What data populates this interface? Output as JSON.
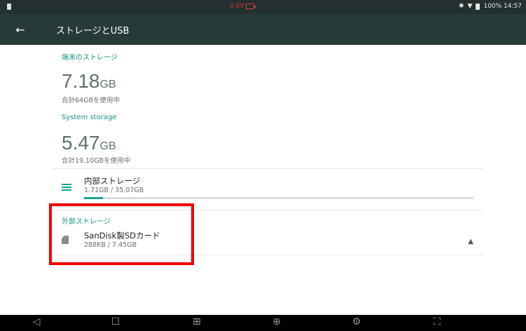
{
  "status_bar": {
    "voltage": "0.0V",
    "right_text": "100% 14:57"
  },
  "toolbar": {
    "back_icon": "←",
    "title": "ストレージとUSB"
  },
  "device_storage": {
    "header": "端末のストレージ",
    "value": "7.18",
    "unit": "GB",
    "caption": "合計64GBを使用中"
  },
  "system_storage": {
    "header": "System storage",
    "value": "5.47",
    "unit": "GB",
    "caption": "合計19.10GBを使用中"
  },
  "internal_storage": {
    "title": "内部ストレージ",
    "usage": "1.71GB / 35.07GB",
    "used_fraction": 0.049
  },
  "external_storage": {
    "header": "外部ストレージ",
    "title": "SanDisk製SDカード",
    "usage": "288KB / 7.45GB",
    "eject_icon": "▲"
  },
  "nav_bar": {
    "back": "◁",
    "home": "☐",
    "apps": "⊞",
    "browser": "⊕",
    "settings": "⚙",
    "screenshot": "⛶"
  },
  "colors": {
    "accent": "#139384",
    "highlight": "#f00000",
    "toolbar": "#263a38"
  }
}
